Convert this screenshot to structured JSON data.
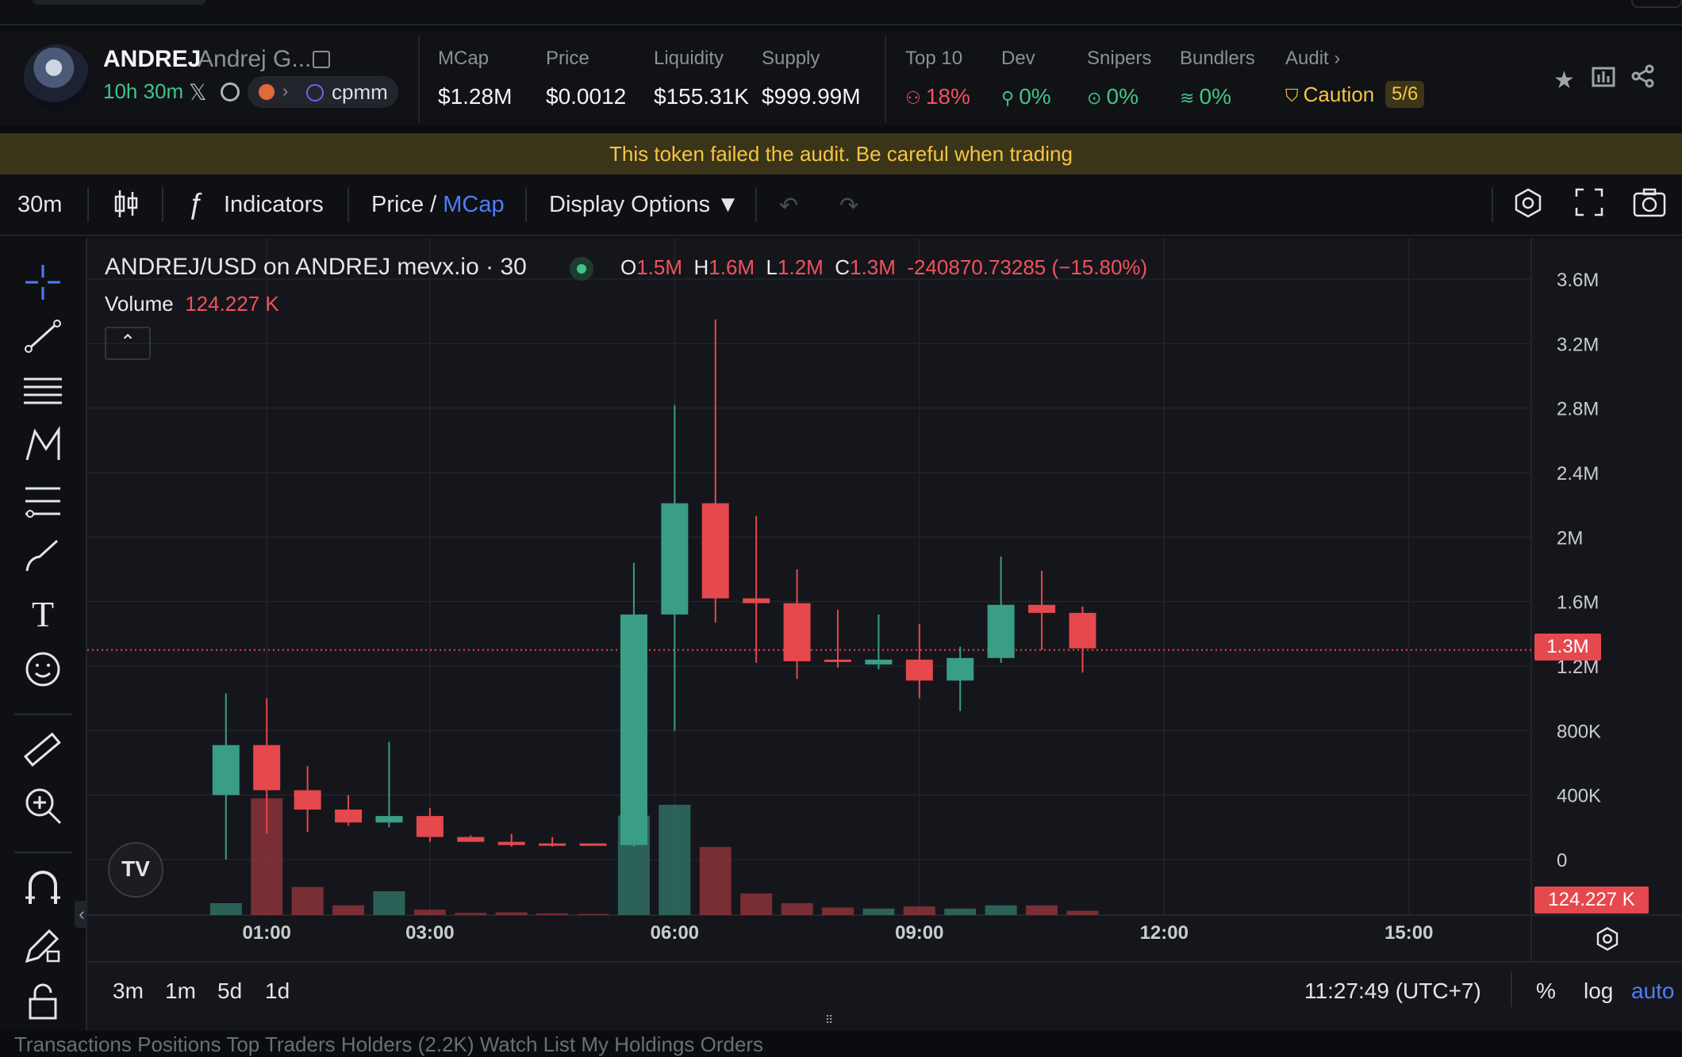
{
  "header": {
    "symbol": "ANDREJ",
    "name": "Andrej G...",
    "age": "10h 30m",
    "pool": "cpmm",
    "stats": [
      {
        "label": "MCap",
        "value": "$1.28M"
      },
      {
        "label": "Price",
        "value": "$0.0012"
      },
      {
        "label": "Liquidity",
        "value": "$155.31K"
      },
      {
        "label": "Supply",
        "value": "$999.99M"
      }
    ],
    "risk": [
      {
        "label": "Top 10",
        "value": "18%"
      },
      {
        "label": "Dev",
        "value": "0%"
      },
      {
        "label": "Snipers",
        "value": "0%"
      },
      {
        "label": "Bundlers",
        "value": "0%"
      }
    ],
    "audit": {
      "label": "Audit",
      "status": "Caution",
      "score": "5/6"
    }
  },
  "warning": "This token failed the audit. Be careful when trading",
  "toolbar": {
    "interval": "30m",
    "indicators": "Indicators",
    "price": "Price",
    "slash": "/",
    "mcap": "MCap",
    "display": "Display Options ▼"
  },
  "legend": {
    "title": "ANDREJ/USD on ANDREJ mevx.io · 30",
    "o_label": "O",
    "o": "1.5M",
    "h_label": "H",
    "h": "1.6M",
    "l_label": "L",
    "l": "1.2M",
    "c_label": "C",
    "c": "1.3M",
    "change": "-240870.73285 (−15.80%)",
    "volume_label": "Volume",
    "volume": "124.227 K"
  },
  "price_tag": "1.3M",
  "volume_tag": "124.227 K",
  "bottom_bar": {
    "ranges": [
      "3m",
      "1m",
      "5d",
      "1d"
    ],
    "time": "11:27:49 (UTC+7)",
    "pct": "%",
    "log": "log",
    "auto": "auto"
  },
  "bottom_tabs_hint": "Transactions   Positions   Top Traders   Holders (2.2K)   Watch List   My Holdings   Orders",
  "colors": {
    "up": "#3a9d85",
    "down": "#e5484d",
    "accent": "#4f7df7"
  },
  "chart_data": {
    "type": "candlestick",
    "y_ticks": [
      "3.6M",
      "3.2M",
      "2.8M",
      "2.4M",
      "2M",
      "1.6M",
      "1.2M",
      "800K",
      "400K",
      "0"
    ],
    "x_ticks": [
      "01:00",
      "03:00",
      "06:00",
      "09:00",
      "12:00",
      "15:00"
    ],
    "ylim": [
      0,
      3600000
    ],
    "x_hours_range": [
      -1.2,
      16.5
    ],
    "current_price": 1300000,
    "candles": [
      {
        "t": 0.5,
        "o": 400000,
        "h": 1030000,
        "l": 0,
        "c": 710000,
        "v": 110000
      },
      {
        "t": 1.0,
        "o": 710000,
        "h": 1000000,
        "l": 160000,
        "c": 430000,
        "v": 1080000
      },
      {
        "t": 1.5,
        "o": 430000,
        "h": 580000,
        "l": 170000,
        "c": 310000,
        "v": 260000
      },
      {
        "t": 2.0,
        "o": 310000,
        "h": 400000,
        "l": 210000,
        "c": 230000,
        "v": 90000
      },
      {
        "t": 2.5,
        "o": 230000,
        "h": 730000,
        "l": 200000,
        "c": 270000,
        "v": 220000
      },
      {
        "t": 3.0,
        "o": 270000,
        "h": 320000,
        "l": 110000,
        "c": 140000,
        "v": 50000
      },
      {
        "t": 3.5,
        "o": 140000,
        "h": 150000,
        "l": 110000,
        "c": 110000,
        "v": 20000
      },
      {
        "t": 4.0,
        "o": 110000,
        "h": 160000,
        "l": 80000,
        "c": 90000,
        "v": 25000
      },
      {
        "t": 4.5,
        "o": 100000,
        "h": 140000,
        "l": 80000,
        "c": 90000,
        "v": 15000
      },
      {
        "t": 5.0,
        "o": 100000,
        "h": 100000,
        "l": 90000,
        "c": 90000,
        "v": 10000
      },
      {
        "t": 5.5,
        "o": 90000,
        "h": 1840000,
        "l": 80000,
        "c": 1520000,
        "v": 920000
      },
      {
        "t": 6.0,
        "o": 1520000,
        "h": 2820000,
        "l": 800000,
        "c": 2210000,
        "v": 1020000
      },
      {
        "t": 6.5,
        "o": 2210000,
        "h": 3350000,
        "l": 1470000,
        "c": 1620000,
        "v": 630000
      },
      {
        "t": 7.0,
        "o": 1620000,
        "h": 2130000,
        "l": 1220000,
        "c": 1590000,
        "v": 200000
      },
      {
        "t": 7.5,
        "o": 1590000,
        "h": 1800000,
        "l": 1120000,
        "c": 1230000,
        "v": 110000
      },
      {
        "t": 8.0,
        "o": 1240000,
        "h": 1550000,
        "l": 1190000,
        "c": 1230000,
        "v": 70000
      },
      {
        "t": 8.5,
        "o": 1210000,
        "h": 1520000,
        "l": 1180000,
        "c": 1240000,
        "v": 60000
      },
      {
        "t": 9.0,
        "o": 1240000,
        "h": 1460000,
        "l": 1000000,
        "c": 1110000,
        "v": 80000
      },
      {
        "t": 9.5,
        "o": 1110000,
        "h": 1320000,
        "l": 920000,
        "c": 1250000,
        "v": 60000
      },
      {
        "t": 10.0,
        "o": 1250000,
        "h": 1880000,
        "l": 1220000,
        "c": 1580000,
        "v": 90000
      },
      {
        "t": 10.5,
        "o": 1580000,
        "h": 1790000,
        "l": 1300000,
        "c": 1530000,
        "v": 90000
      },
      {
        "t": 11.0,
        "o": 1530000,
        "h": 1570000,
        "l": 1160000,
        "c": 1310000,
        "v": 40000
      }
    ]
  }
}
